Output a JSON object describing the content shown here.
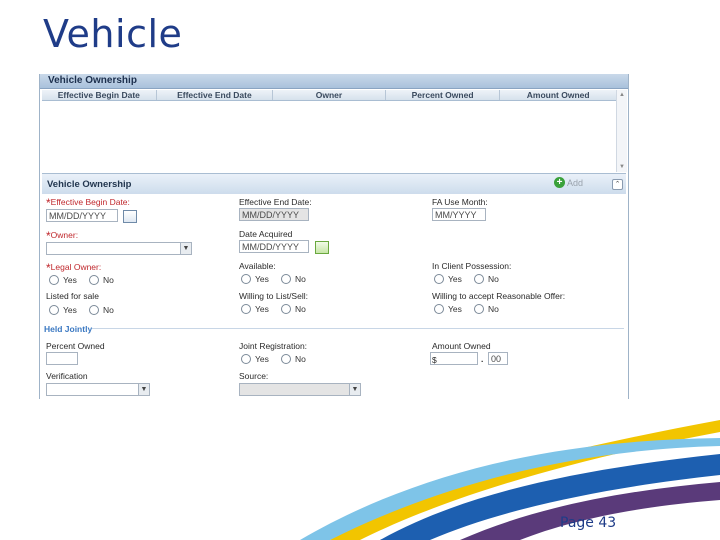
{
  "slide": {
    "title": "Vehicle",
    "page_label": "Page 43"
  },
  "ownership_grid": {
    "panel_title": "Vehicle Ownership",
    "columns": [
      "Effective Begin Date",
      "Effective End Date",
      "Owner",
      "Percent Owned",
      "Amount Owned"
    ]
  },
  "form": {
    "section_title": "Vehicle Ownership",
    "add_label": "Add",
    "effective_begin_date": {
      "label": "Effective Begin Date:",
      "placeholder": "MM/DD/YYYY",
      "required": true
    },
    "effective_end_date": {
      "label": "Effective End Date:",
      "placeholder": "MM/DD/YYYY"
    },
    "fa_use_month": {
      "label": "FA Use Month:",
      "placeholder": "MM/YYYY"
    },
    "owner": {
      "label": "Owner:",
      "value": "",
      "required": true
    },
    "date_acquired": {
      "label": "Date Acquired",
      "placeholder": "MM/DD/YYYY"
    },
    "legal_owner": {
      "label": "Legal Owner:",
      "required": true
    },
    "available": {
      "label": "Available:"
    },
    "in_client_possession": {
      "label": "In Client Possession:"
    },
    "listed_for_sale": {
      "label": "Listed for sale"
    },
    "willing_to_list_sell": {
      "label": "Willing to List/Sell:"
    },
    "willing_to_accept_offer": {
      "label": "Willing to accept Reasonable Offer:"
    },
    "held_jointly": "Held Jointly",
    "percent_owned": {
      "label": "Percent Owned",
      "value": ""
    },
    "joint_registration": {
      "label": "Joint Registration:"
    },
    "amount_owned": {
      "label": "Amount Owned",
      "currency": "$",
      "dollars": "",
      "decimal_sep": ".",
      "cents": "00"
    },
    "verification": {
      "label": "Verification",
      "value": ""
    },
    "source": {
      "label": "Source:",
      "value": ""
    },
    "yes": "Yes",
    "no": "No"
  },
  "colors": {
    "title": "#1f3c88",
    "required": "#c0282d",
    "swoosh_blue": "#1d5fb0",
    "swoosh_yellow": "#f2c500",
    "swoosh_purple": "#5a3a7a",
    "swoosh_light_blue": "#7ec4e8"
  }
}
